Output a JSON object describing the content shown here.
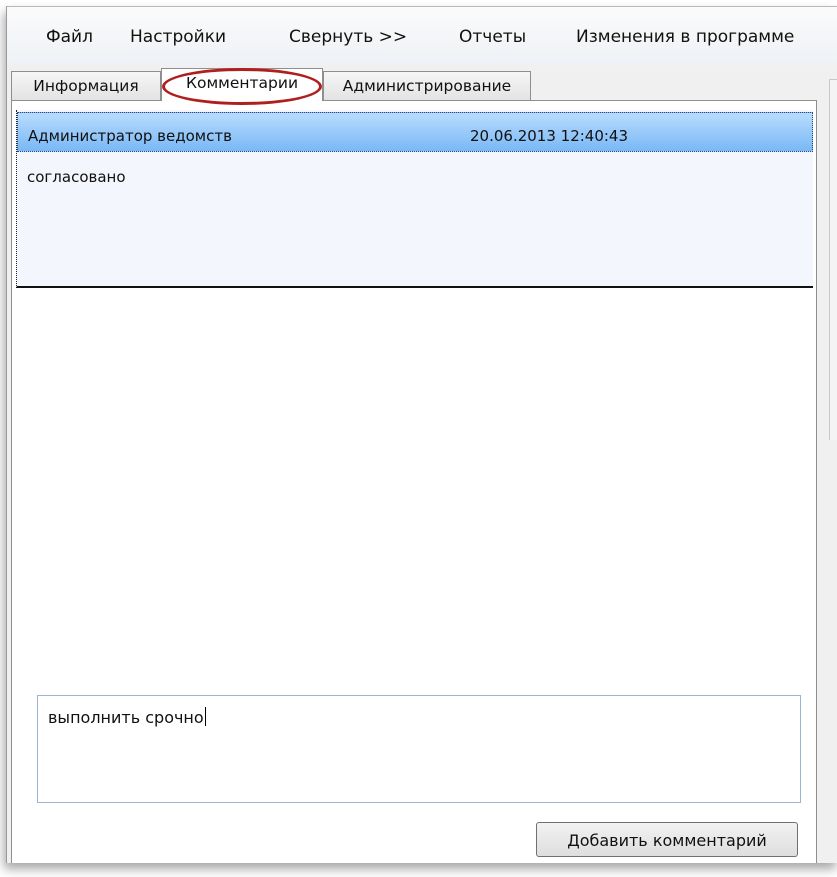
{
  "menu": {
    "items": [
      {
        "label": "Файл"
      },
      {
        "label": "Настройки"
      },
      {
        "label": "Свернуть >>"
      },
      {
        "label": "Отчеты"
      },
      {
        "label": "Изменения в программе"
      }
    ]
  },
  "tabs": [
    {
      "label": "Информация",
      "active": false
    },
    {
      "label": "Комментарии",
      "active": true
    },
    {
      "label": "Администрирование",
      "active": false
    }
  ],
  "comments": [
    {
      "author": "Администратор ведомств",
      "date": "20.06.2013 12:40:43",
      "text": "согласовано",
      "selected": true
    }
  ],
  "new_comment": {
    "value": "выполнить срочно"
  },
  "add_button": {
    "label": "Добавить комментарий"
  },
  "colors": {
    "selection_highlight": "#79b8f5",
    "annotation_oval": "#b01e1e"
  }
}
